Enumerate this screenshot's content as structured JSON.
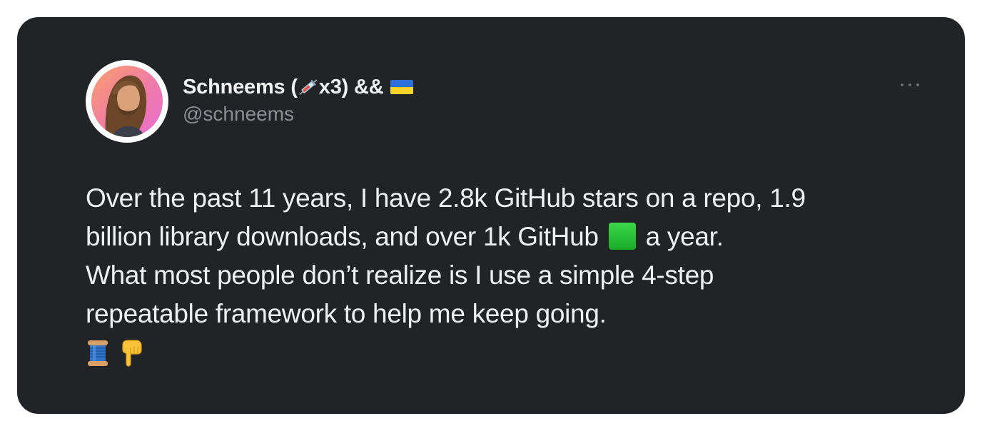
{
  "tweet": {
    "author": {
      "name": "Schneems (",
      "name_suffix": "x3) &&",
      "handle": "@schneems",
      "name_emoji": [
        "syringe-icon",
        "ukraine-flag-icon"
      ]
    },
    "lines": [
      "Over the past 11 years, I have 2.8k GitHub stars on a repo, 1.9",
      "billion library downloads, and over 1k GitHub",
      "a year.",
      "What most people don’t realize is I use a simple 4-step",
      "repeatable framework to help me keep going."
    ],
    "inline_emoji": "green-square-icon",
    "trailing_emoji": [
      "thread-spool-icon",
      "pointing-down-icon"
    ]
  },
  "colors": {
    "card_background": "#212327",
    "text": "#eef0f2",
    "handle": "#8b8f94",
    "flag_blue": "#2d6fd8",
    "flag_yellow": "#f9d52b"
  }
}
